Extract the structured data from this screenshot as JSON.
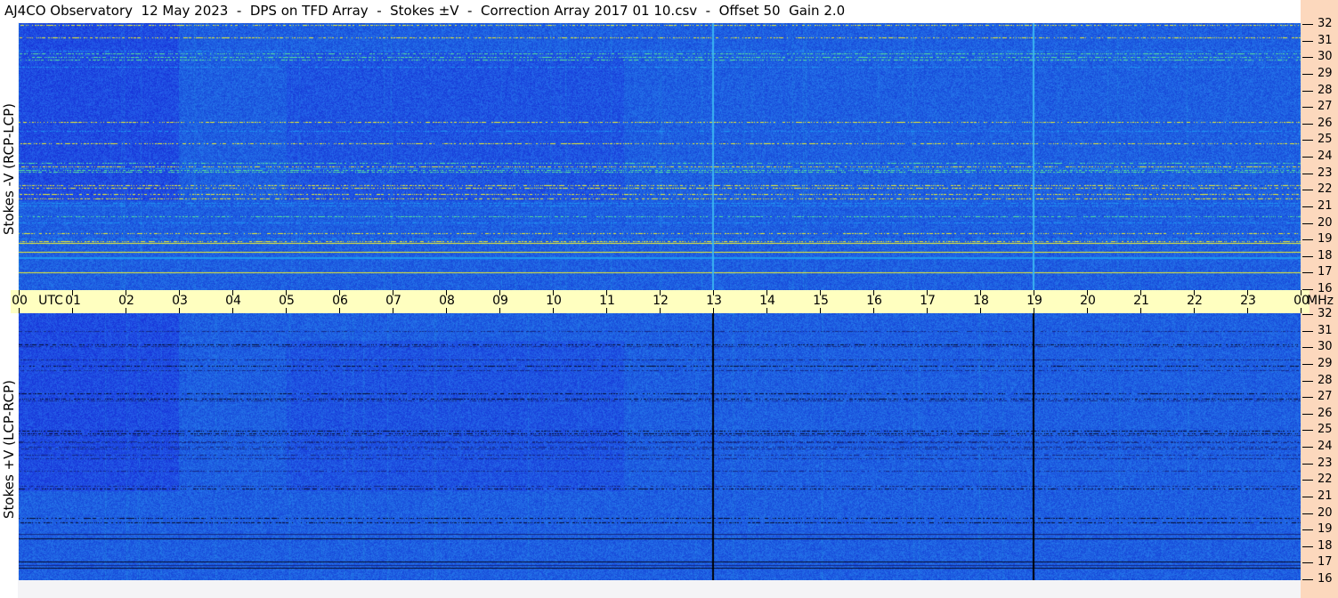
{
  "title": "AJ4CO Observatory  12 May 2023  -  DPS on TFD Array  -  Stokes ±V  -  Correction Array 2017 01 10.csv  -  Offset 50  Gain 2.0",
  "chart_data": [
    {
      "type": "heatmap",
      "ylabel": "Stokes -V (RCP-LCP)",
      "yticks": [
        32,
        31,
        30,
        29,
        28,
        27,
        26,
        25,
        24,
        23,
        22,
        21,
        20,
        19,
        18,
        17,
        16
      ],
      "ylim": [
        16,
        32
      ],
      "marker_color": "#3ab4f0",
      "colormap": [
        "#000000",
        "#1030c0",
        "#2060e8",
        "#30a8f0",
        "#60f0a0",
        "#f0f020",
        "#ff4040",
        "#ff60ff"
      ]
    },
    {
      "type": "heatmap",
      "ylabel": "Stokes +V (LCP-RCP)",
      "yticks": [
        32,
        31,
        30,
        29,
        28,
        27,
        26,
        25,
        24,
        23,
        22,
        21,
        20,
        19,
        18,
        17,
        16
      ],
      "ylim": [
        16,
        32
      ],
      "marker_color": "#000000"
    }
  ],
  "xaxis": {
    "unit_label": "UTC",
    "freq_unit": "MHz",
    "ticks": [
      "00",
      "01",
      "02",
      "03",
      "04",
      "05",
      "06",
      "07",
      "08",
      "09",
      "10",
      "11",
      "12",
      "13",
      "14",
      "15",
      "16",
      "17",
      "18",
      "19",
      "20",
      "21",
      "22",
      "23",
      "00"
    ],
    "markers_hours": [
      13,
      19
    ]
  }
}
